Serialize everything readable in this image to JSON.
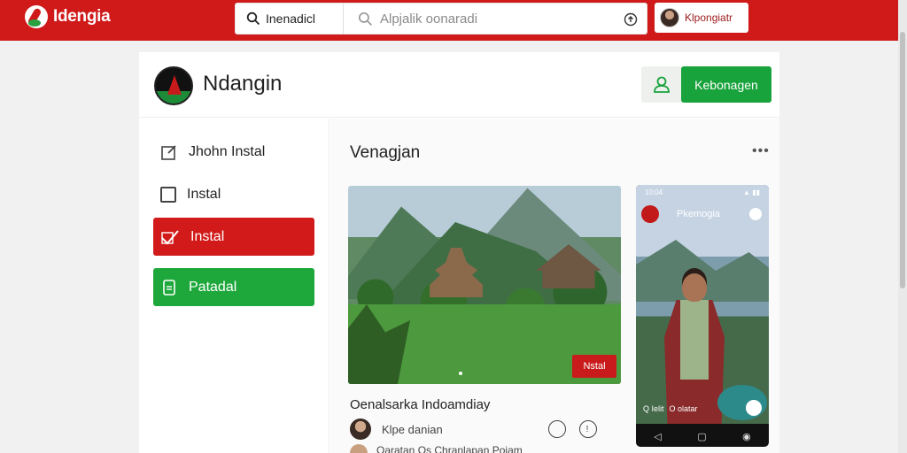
{
  "header": {
    "brand": "Idengia",
    "search": {
      "scope_label": "Inenadicl",
      "placeholder": "Alpjalik oonaradi"
    },
    "user": {
      "name": "Klpongiatr"
    }
  },
  "page": {
    "title": "Ndangin",
    "primary_button": "Kebonagen"
  },
  "sidebar": {
    "items": [
      {
        "label": "Jhohn Instal",
        "state": "default"
      },
      {
        "label": "Instal",
        "state": "default"
      },
      {
        "label": "Instal",
        "state": "active-red"
      },
      {
        "label": "Patadal",
        "state": "active-green"
      }
    ]
  },
  "content": {
    "section_title": "Venagjan",
    "more": "•••",
    "featured": {
      "badge": "Nstal",
      "title": "Oenalsarka Indoamdiay",
      "author": "Klpe danian",
      "sub_line": "Oaratan Os Chranlapan Pojam"
    },
    "phone": {
      "status_left": "10:04",
      "status_right": "▲ ▮▮",
      "app_name": "Pkemogia",
      "caption_left": "Q Ielit",
      "caption_right": "O olatar"
    }
  },
  "colors": {
    "brand_red": "#d01919",
    "accent_green": "#19a33c"
  }
}
